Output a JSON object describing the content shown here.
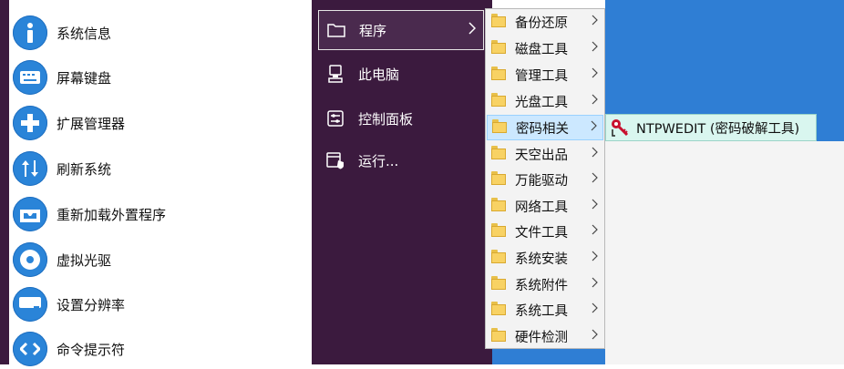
{
  "tools": [
    {
      "label": "系统信息",
      "icon": "info-icon"
    },
    {
      "label": "屏幕键盘",
      "icon": "keyboard-icon"
    },
    {
      "label": "扩展管理器",
      "icon": "plus-icon"
    },
    {
      "label": "刷新系统",
      "icon": "refresh-arrows-icon"
    },
    {
      "label": "重新加载外置程序",
      "icon": "tray-icon"
    },
    {
      "label": "虚拟光驱",
      "icon": "disc-icon"
    },
    {
      "label": "设置分辨率",
      "icon": "resolution-icon"
    },
    {
      "label": "命令提示符",
      "icon": "code-icon"
    }
  ],
  "startmenu": {
    "items": [
      {
        "label": "程序",
        "icon": "folder-icon",
        "has_submenu": true
      },
      {
        "label": "此电脑",
        "icon": "computer-icon",
        "has_submenu": false
      },
      {
        "label": "控制面板",
        "icon": "control-panel-icon",
        "has_submenu": false
      },
      {
        "label": "运行...",
        "icon": "run-icon",
        "has_submenu": false
      }
    ]
  },
  "programs_submenu": {
    "items": [
      {
        "label": "备份还原"
      },
      {
        "label": "磁盘工具"
      },
      {
        "label": "管理工具"
      },
      {
        "label": "光盘工具"
      },
      {
        "label": "密码相关"
      },
      {
        "label": "天空出品"
      },
      {
        "label": "万能驱动"
      },
      {
        "label": "网络工具"
      },
      {
        "label": "文件工具"
      },
      {
        "label": "系统安装"
      },
      {
        "label": "系统附件"
      },
      {
        "label": "系统工具"
      },
      {
        "label": "硬件检测"
      }
    ],
    "active_label": "密码相关"
  },
  "password_submenu": {
    "item": {
      "label": "NTPWEDIT (密码破解工具)",
      "icon": "key-icon"
    }
  },
  "colors": {
    "accent": "#2a84d8",
    "menu_bg": "#3b1a3e",
    "highlight": "#cce8ff",
    "third_highlight": "#d9f6ef"
  }
}
